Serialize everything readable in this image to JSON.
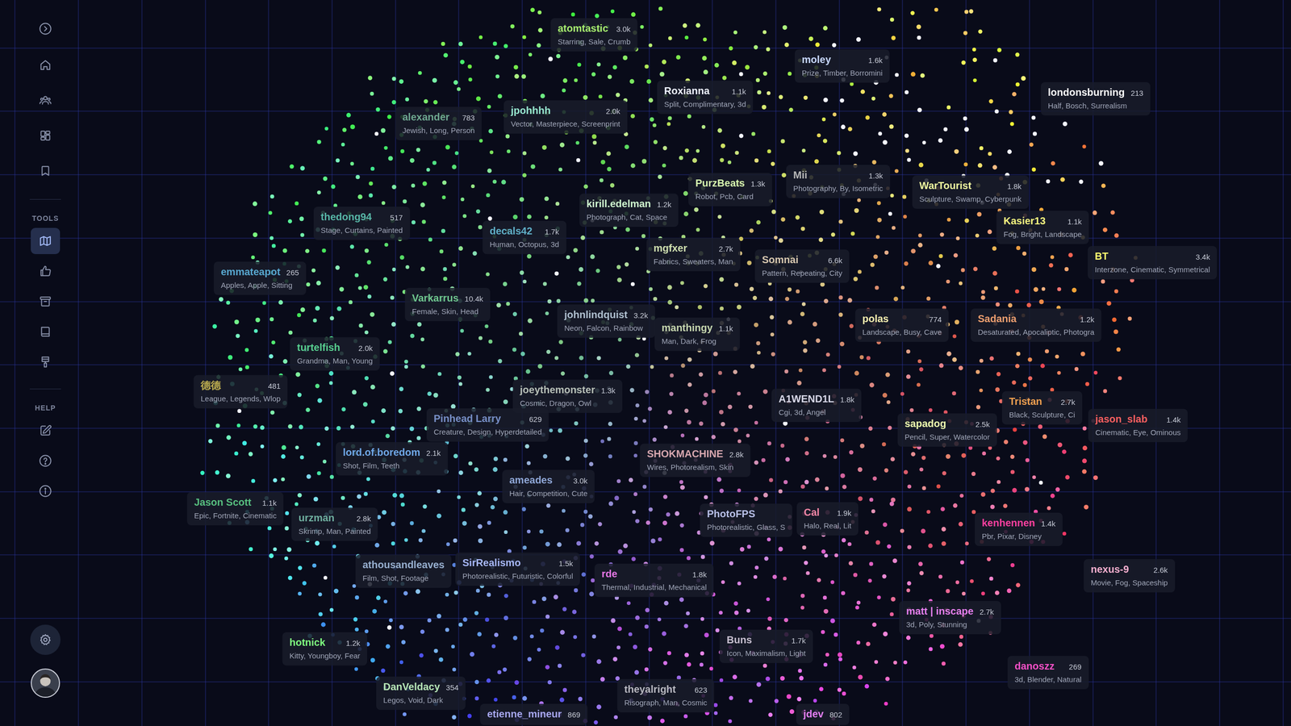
{
  "sidebar": {
    "main": [
      {
        "selected": false
      },
      {
        "selected": false
      },
      {
        "selected": false
      },
      {
        "selected": false
      }
    ],
    "tools_label": "TOOLS",
    "tools": [
      {
        "selected": true
      },
      {
        "selected": false
      },
      {
        "selected": false
      },
      {
        "selected": false
      },
      {
        "selected": false
      }
    ],
    "help_label": "HELP",
    "help": [
      {
        "selected": false
      },
      {
        "selected": false
      },
      {
        "selected": false
      }
    ]
  },
  "labels": [
    {
      "name": "atomtastic",
      "count": "3.0k",
      "tags": "Starring, Sale, Crumb",
      "color": "#a8f070"
    },
    {
      "name": "moley",
      "count": "1.6k",
      "tags": "Prize, Timber, Borromini",
      "color": "#c8d8ff"
    },
    {
      "name": "londonsburning",
      "count": "213",
      "tags": "Half, Bosch, Surrealism",
      "color": "#ffffff"
    },
    {
      "name": "Roxianna",
      "count": "1.1k",
      "tags": "Split, Complimentary, 3d",
      "color": "#f0f4ff"
    },
    {
      "name": "alexander",
      "count": "783",
      "tags": "Jewish, Long, Person",
      "color": "#6fa890"
    },
    {
      "name": "jpohhhh",
      "count": "2.0k",
      "tags": "Vector, Masterpiece, Screenprint",
      "color": "#98e8d0"
    },
    {
      "name": "PurzBeats",
      "count": "1.3k",
      "tags": "Robot, Pcb, Card",
      "color": "#d8f8b0"
    },
    {
      "name": "Mii",
      "count": "1.3k",
      "tags": "Photography, By, Isometric",
      "color": "#b8b8b8"
    },
    {
      "name": "WarTourist",
      "count": "1.8k",
      "tags": "Sculpture, Swamp, Cyberpunk",
      "color": "#f0f8a0"
    },
    {
      "name": "kirill.edelman",
      "count": "1.2k",
      "tags": "Photograph, Cat, Space",
      "color": "#d0f8d0"
    },
    {
      "name": "thedong94",
      "count": "517",
      "tags": "Stage, Curtains, Painted",
      "color": "#58b8a8"
    },
    {
      "name": "decals42",
      "count": "1.7k",
      "tags": "Human, Octopus, 3d",
      "color": "#60b0c8"
    },
    {
      "name": "Kasier13",
      "count": "1.1k",
      "tags": "Fog, Bright, Landscape",
      "color": "#f8f880"
    },
    {
      "name": "mgfxer",
      "count": "2.7k",
      "tags": "Fabrics, Sweaters, Man",
      "color": "#d0e0b0"
    },
    {
      "name": "Somnai",
      "count": "6.6k",
      "tags": "Pattern, Repeating, City",
      "color": "#d8c8b0"
    },
    {
      "name": "BT",
      "count": "3.4k",
      "tags": "Interzone, Cinematic, Symmetrical",
      "color": "#ffff70"
    },
    {
      "name": "emmateapot",
      "count": "265",
      "tags": "Apples, Apple, Sitting",
      "color": "#58a8d0"
    },
    {
      "name": "Varkarrus",
      "count": "10.4k",
      "tags": "Female, Skin, Head",
      "color": "#70c890"
    },
    {
      "name": "johnlindquist",
      "count": "3.2k",
      "tags": "Neon, Falcon, Rainbow",
      "color": "#b0c0d0"
    },
    {
      "name": "manthingy",
      "count": "1.1k",
      "tags": "Man, Dark, Frog",
      "color": "#c8d8b0"
    },
    {
      "name": "polas",
      "count": "774",
      "tags": "Landscape, Busy, Cave",
      "color": "#f8f0b0"
    },
    {
      "name": "Sadania",
      "count": "1.2k",
      "tags": "Desaturated, Apocaliptic, Photogra",
      "color": "#f0a070"
    },
    {
      "name": "turtelfish",
      "count": "2.0k",
      "tags": "Grandma, Man, Young",
      "color": "#58d090"
    },
    {
      "name": "德德",
      "count": "481",
      "tags": "League, Legends, Wlop",
      "color": "#c0b050"
    },
    {
      "name": "joeythemonster",
      "count": "1.3k",
      "tags": "Cosmic, Dragon, Owl",
      "color": "#b8c0b8"
    },
    {
      "name": "A1WEND1L",
      "count": "1.8k",
      "tags": "Cgi, 3d, Angel",
      "color": "#d8d8e8"
    },
    {
      "name": "Tristan",
      "count": "2.7k",
      "tags": "Black, Sculpture, Ci",
      "color": "#f0a050"
    },
    {
      "name": "jason_slab",
      "count": "1.4k",
      "tags": "Cinematic, Eye, Ominous",
      "color": "#ff6060"
    },
    {
      "name": "sapadog",
      "count": "2.5k",
      "tags": "Pencil, Super, Watercolor",
      "color": "#f0ffb0"
    },
    {
      "name": "Pinhead Larry",
      "count": "629",
      "tags": "Creature, Design, Hyperdetailed",
      "color": "#7890c8"
    },
    {
      "name": "lord.of.boredom",
      "count": "2.1k",
      "tags": "Shot, Film, Teeth",
      "color": "#70a8e8"
    },
    {
      "name": "SHOKMACHINE",
      "count": "2.8k",
      "tags": "Wires, Photorealism, Skin",
      "color": "#d8a8b0"
    },
    {
      "name": "ameades",
      "count": "3.0k",
      "tags": "Hair, Competition, Cute",
      "color": "#90a8d8"
    },
    {
      "name": "Jason Scott",
      "count": "1.1k",
      "tags": "Epic, Fortnite, Cinematic",
      "color": "#58c080"
    },
    {
      "name": "urzman",
      "count": "2.8k",
      "tags": "Skrimp, Man, Painted",
      "color": "#70b0a0"
    },
    {
      "name": "PhotoFPS",
      "tags": "Photorealistic, Glass, S",
      "color": "#b8c0e8"
    },
    {
      "name": "Cal",
      "count": "1.9k",
      "tags": "Halo, Real, Lit",
      "color": "#f888a8"
    },
    {
      "name": "kenhennen",
      "count": "1.4k",
      "tags": "Pbr, Pixar, Disney",
      "color": "#ff40a0"
    },
    {
      "name": "nexus-9",
      "count": "2.6k",
      "tags": "Movie, Fog, Spaceship",
      "color": "#f8b0d0"
    },
    {
      "name": "athousandleaves",
      "tags": "Film, Shot, Footage",
      "color": "#98b0d0"
    },
    {
      "name": "SirRealismo",
      "count": "1.5k",
      "tags": "Photorealistic, Futuristic, Colorful",
      "color": "#a8b8f8"
    },
    {
      "name": "rde",
      "count": "1.8k",
      "tags": "Thermal, Industrial, Mechanical",
      "color": "#e878e8"
    },
    {
      "name": "matt | inscape",
      "count": "2.7k",
      "tags": "3d, Poly, Stunning",
      "color": "#e880f0"
    },
    {
      "name": "hotnick",
      "count": "1.2k",
      "tags": "Kitty, Youngboy, Fear",
      "color": "#80ff80"
    },
    {
      "name": "Buns",
      "count": "1.7k",
      "tags": "Icon, Maximalism, Light",
      "color": "#c8c0d0"
    },
    {
      "name": "danoszz",
      "count": "269",
      "tags": "3d, Blender, Natural",
      "color": "#f850c8"
    },
    {
      "name": "DanVeldacy",
      "count": "354",
      "tags": "Legos, Void, Dark",
      "color": "#b8e8b8"
    },
    {
      "name": "theyalright",
      "count": "623",
      "tags": "Risograph, Man, Cosmic",
      "color": "#b8b8c0"
    },
    {
      "name": "etienne_mineur",
      "count": "869",
      "color": "#a8a8f0"
    },
    {
      "name": "jdev",
      "count": "802",
      "color": "#e880f8"
    }
  ]
}
